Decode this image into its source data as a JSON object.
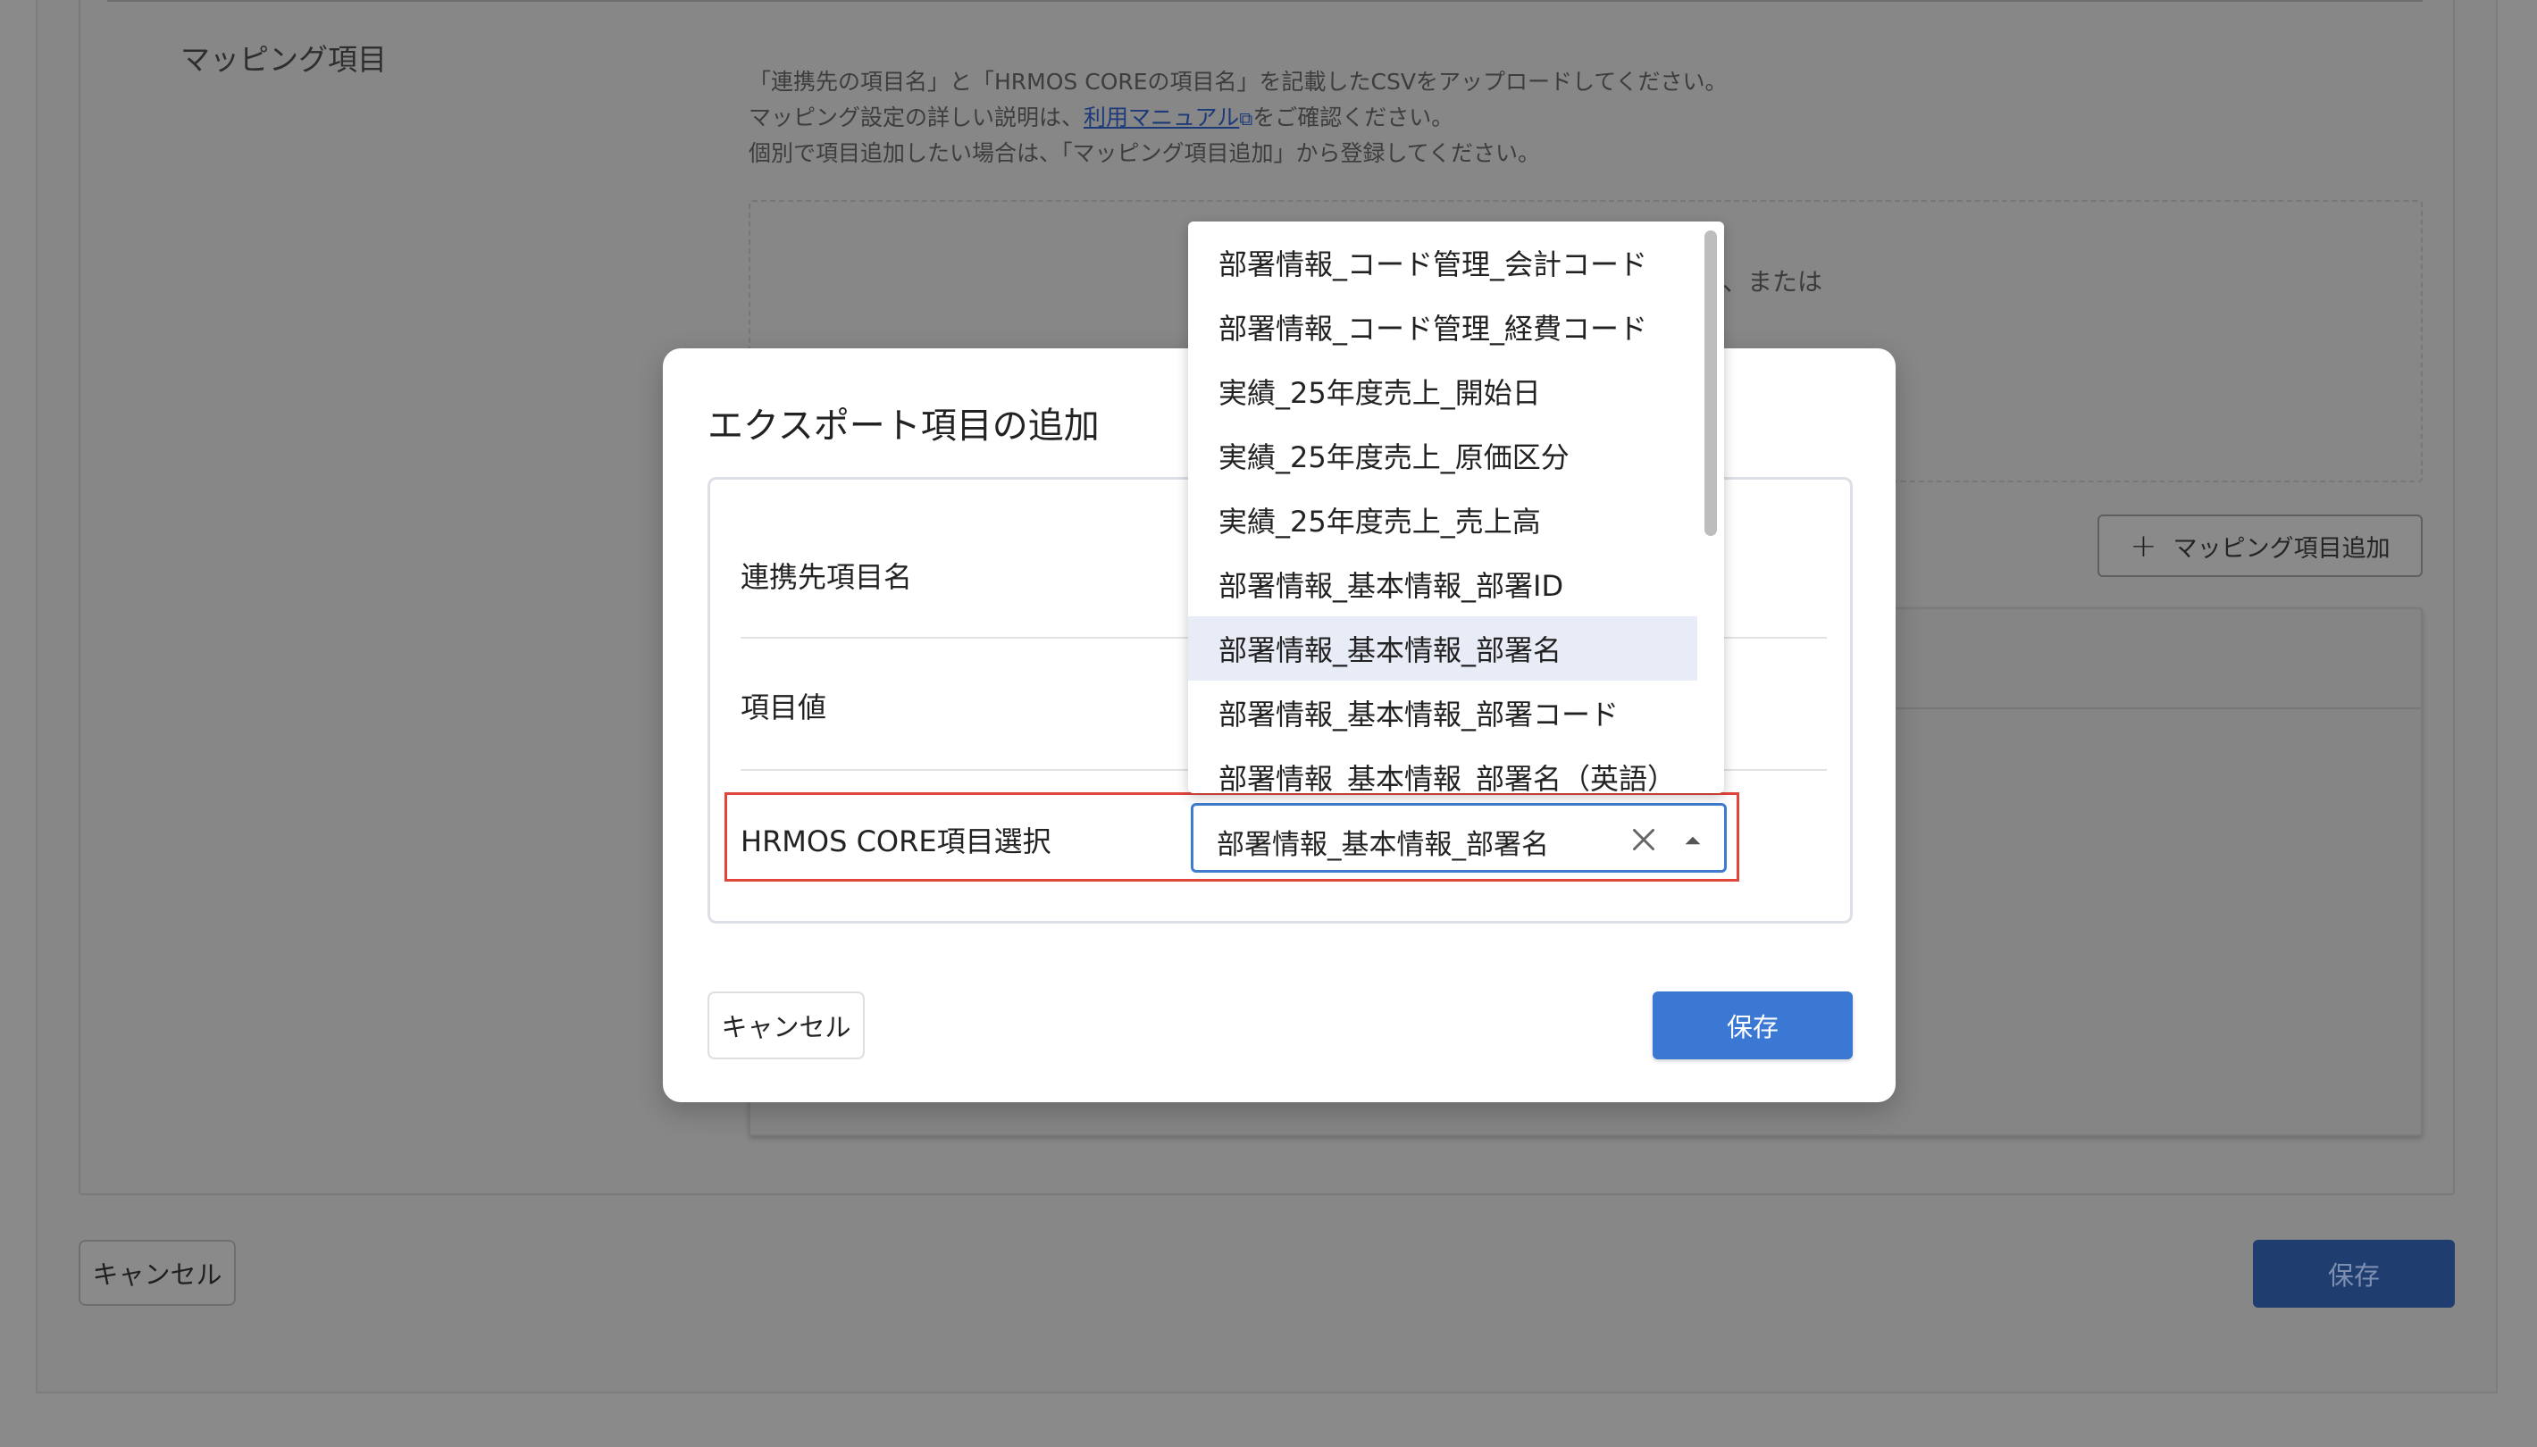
{
  "background": {
    "section_title": "マッピング項目",
    "desc_line1": "「連携先の項目名」と「HRMOS COREの項目名」を記載したCSVをアップロードしてください。",
    "desc_line2_pre": "マッピング設定の詳しい説明は、",
    "desc_line2_link": "利用マニュアル",
    "desc_line2_post": "をご確認ください。",
    "desc_line3": "個別で項目追加したい場合は、「マッピング項目追加」から登録してください。",
    "upload_text": "ら、または",
    "add_button_label": "マッピング項目追加",
    "cancel_label": "キャンセル",
    "save_label": "保存"
  },
  "modal": {
    "title": "エクスポート項目の追加",
    "fields": {
      "partner_field_label": "連携先項目名",
      "value_label": "項目値",
      "core_select_label": "HRMOS CORE項目選択"
    },
    "select_value": "部署情報_基本情報_部署名",
    "cancel_label": "キャンセル",
    "save_label": "保存"
  },
  "dropdown": {
    "items": [
      "部署情報_コード管理_会計コード",
      "部署情報_コード管理_経費コード",
      "実績_25年度売上_開始日",
      "実績_25年度売上_原価区分",
      "実績_25年度売上_売上高",
      "部署情報_基本情報_部署ID",
      "部署情報_基本情報_部署名",
      "部署情報_基本情報_部署コード",
      "部署情報_基本情報_部署名（英語）"
    ],
    "selected": "部署情報_基本情報_部署名"
  },
  "colors": {
    "primary": "#3a78d4",
    "highlight": "#e2463a",
    "selected_row": "#e8ecf6"
  }
}
